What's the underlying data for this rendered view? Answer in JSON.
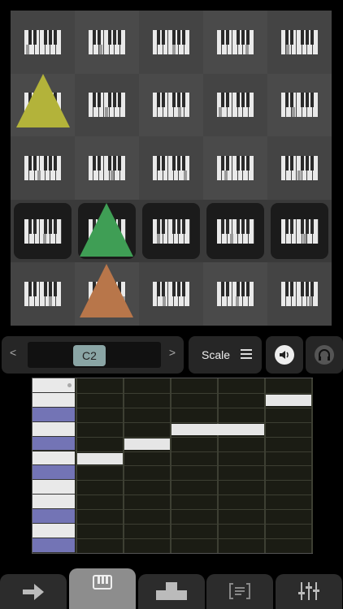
{
  "controls": {
    "prev_arrow": "<",
    "next_arrow": ">",
    "note_value": "C2",
    "scale_label": "Scale"
  },
  "icons": {
    "menu": "hamburger-icon",
    "speaker": "speaker-icon",
    "headphones": "headphones-icon",
    "tab1": "arrow-right-icon",
    "tab2": "piano-icon",
    "tab3": "block-stack-icon",
    "tab4": "bracket-list-icon",
    "tab5": "mixer-sliders-icon"
  },
  "colors": {
    "accent_note": "#8aa5a5",
    "black_key": "#7374b5",
    "triangle_yellow": "#b3b33a",
    "triangle_green": "#3f9e55",
    "triangle_orange": "#b8764a"
  },
  "tabs": {
    "active_index": 1
  }
}
